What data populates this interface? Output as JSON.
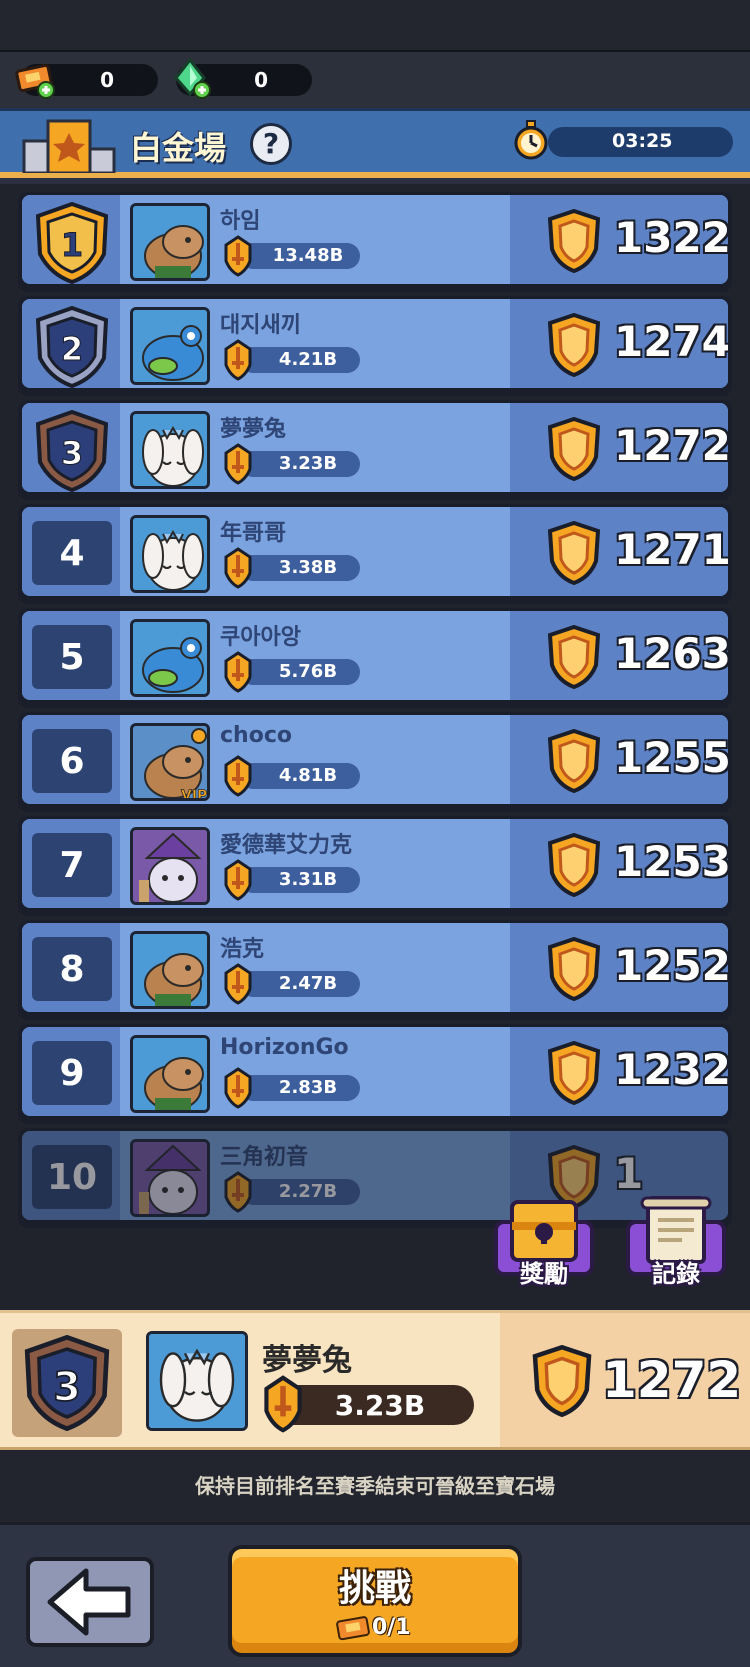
{
  "currency": {
    "tickets": "0",
    "gems": "0"
  },
  "header": {
    "title": "白金場",
    "timer": "03:25"
  },
  "leaderboard": [
    {
      "rank": "1",
      "name": "하임",
      "power": "13.48B",
      "score": "1322",
      "avatar": "capybara-icon"
    },
    {
      "rank": "2",
      "name": "대지새끼",
      "power": "4.21B",
      "score": "1274",
      "avatar": "blue-frog-icon"
    },
    {
      "rank": "3",
      "name": "夢夢兔",
      "power": "3.23B",
      "score": "1272",
      "avatar": "white-bunny-icon"
    },
    {
      "rank": "4",
      "name": "年哥哥",
      "power": "3.38B",
      "score": "1271",
      "avatar": "white-bunny-icon"
    },
    {
      "rank": "5",
      "name": "쿠아아앙",
      "power": "5.76B",
      "score": "1263",
      "avatar": "blue-frog-icon"
    },
    {
      "rank": "6",
      "name": "choco",
      "power": "4.81B",
      "score": "1255",
      "avatar": "capybara-vip-icon"
    },
    {
      "rank": "7",
      "name": "愛德華艾力克",
      "power": "3.31B",
      "score": "1253",
      "avatar": "purple-wizard-icon"
    },
    {
      "rank": "8",
      "name": "浩克",
      "power": "2.47B",
      "score": "1252",
      "avatar": "capybara-icon"
    },
    {
      "rank": "9",
      "name": "HorizonGo",
      "power": "2.83B",
      "score": "1232",
      "avatar": "capybara-icon"
    },
    {
      "rank": "10",
      "name": "三角初音",
      "power": "2.27B",
      "score": "1",
      "avatar": "purple-wizard-icon"
    }
  ],
  "buttons": {
    "rewards": "獎勵",
    "records": "記錄",
    "challenge": "挑戰",
    "challenge_cost": "0/1"
  },
  "me": {
    "rank": "3",
    "name": "夢夢兔",
    "power": "3.23B",
    "score": "1272"
  },
  "promo_text": "保持目前排名至賽季結束可晉級至寶石場",
  "colors": {
    "gold": "#f5a623",
    "row_blue": "#7aa3df",
    "dark_blue": "#2d4372",
    "my_row": "#f9e4c2"
  }
}
